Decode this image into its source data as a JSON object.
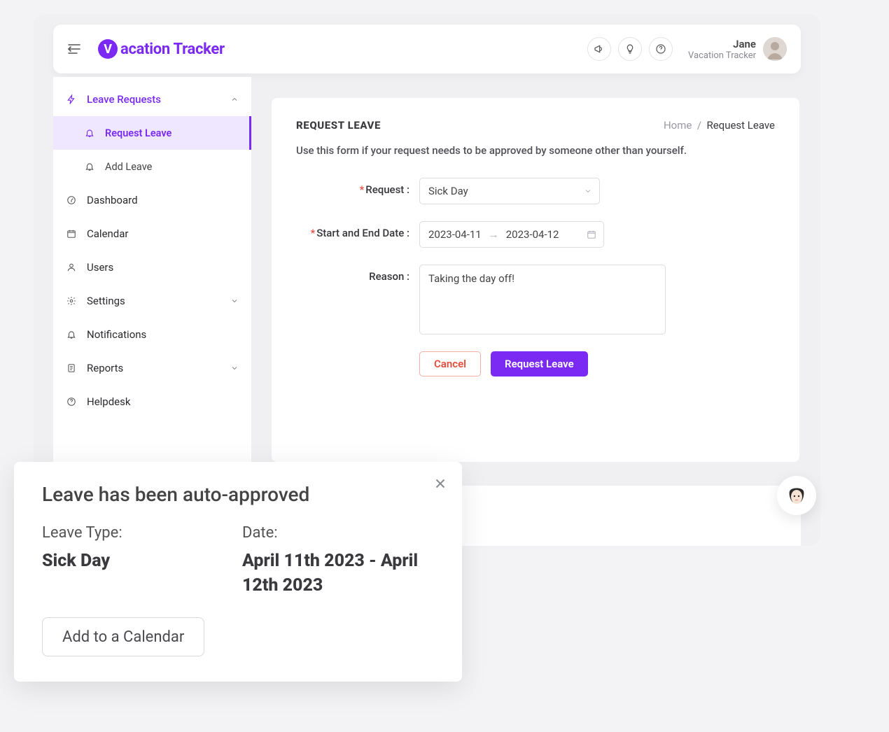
{
  "header": {
    "brand": "acation Tracker",
    "user_name": "Jane",
    "user_sub": "Vacation Tracker"
  },
  "sidebar": {
    "parent_label": "Leave Requests",
    "sub1": "Request Leave",
    "sub2": "Add Leave",
    "items": {
      "dashboard": "Dashboard",
      "calendar": "Calendar",
      "users": "Users",
      "settings": "Settings",
      "notifications": "Notifications",
      "reports": "Reports",
      "helpdesk": "Helpdesk"
    }
  },
  "main": {
    "title": "REQUEST LEAVE",
    "breadcrumb_home": "Home",
    "breadcrumb_sep": "/",
    "breadcrumb_current": "Request Leave",
    "desc": "Use this form if your request needs to be approved by someone other than yourself.",
    "labels": {
      "request": "Request :",
      "dates": "Start and End Date :",
      "reason": "Reason :"
    },
    "values": {
      "request": "Sick Day",
      "start_date": "2023-04-11",
      "end_date": "2023-04-12",
      "reason": "Taking the day off!"
    },
    "buttons": {
      "cancel": "Cancel",
      "submit": "Request Leave"
    }
  },
  "toast": {
    "title": "Leave has been auto-approved",
    "type_label": "Leave Type:",
    "type_value": "Sick Day",
    "date_label": "Date:",
    "date_value": "April 11th 2023 - April 12th 2023",
    "button": "Add to a Calendar"
  }
}
